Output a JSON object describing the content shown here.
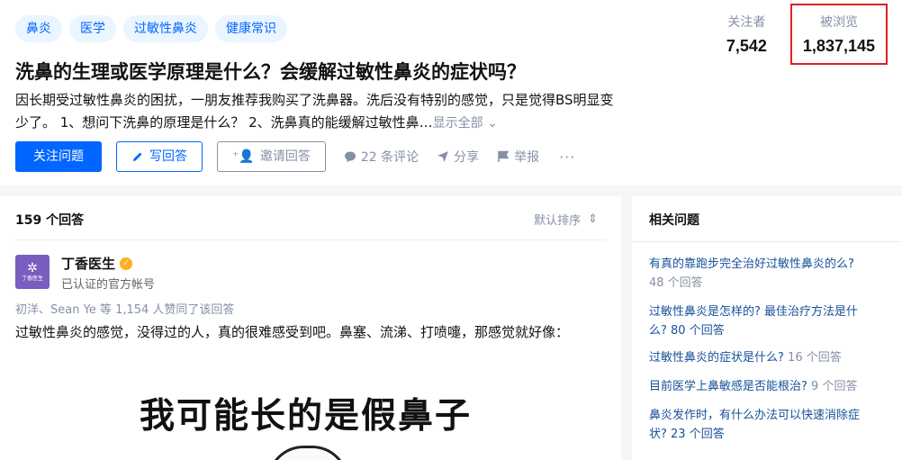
{
  "tags": [
    "鼻炎",
    "医学",
    "过敏性鼻炎",
    "健康常识"
  ],
  "stats": {
    "followers_label": "关注者",
    "followers_value": "7,542",
    "views_label": "被浏览",
    "views_value": "1,837,145"
  },
  "question": {
    "title": "洗鼻的生理或医学原理是什么？会缓解过敏性鼻炎的症状吗？",
    "desc_line1": "因长期受过敏性鼻炎的困扰，一朋友推荐我购买了洗鼻器。洗后没有特别的感觉，只是觉得BS明显变",
    "desc_line2": "少了。 1、想问下洗鼻的原理是什么？ 2、洗鼻真的能缓解过敏性鼻…",
    "show_all": "显示全部"
  },
  "actions": {
    "follow": "关注问题",
    "write": "写回答",
    "invite": "邀请回答",
    "comments": "22 条评论",
    "share": "分享",
    "report": "举报",
    "more": "···"
  },
  "answers": {
    "count_label": "159 个回答",
    "sort_label": "默认排序",
    "author_name": "丁香医生",
    "avatar_text": "丁香医生",
    "author_sub": "已认证的官方帐号",
    "likes_text": "初洋、Sean Ye 等 1,154 人赞同了该回答",
    "first_paragraph": "过敏性鼻炎的感觉，没得过的人，真的很难感受到吧。鼻塞、流涕、打喷嚏，那感觉就好像：",
    "meme_caption": "我可能长的是假鼻子"
  },
  "related": {
    "title": "相关问题",
    "items": [
      {
        "line1": "有真的靠跑步完全治好过敏性鼻炎的么?",
        "line2": "48 个回答"
      },
      {
        "line1": "过敏性鼻炎是怎样的? 最佳治疗方法是什",
        "line2": "么? 80 个回答"
      },
      {
        "line1": "过敏性鼻炎的症状是什么?",
        "line2": "16 个回答"
      },
      {
        "line1": "目前医学上鼻敏感是否能根治?",
        "line2": "9 个回答"
      },
      {
        "line1": "鼻炎发作时，有什么办法可以快速消除症",
        "line2": "状? 23 个回答"
      }
    ]
  }
}
